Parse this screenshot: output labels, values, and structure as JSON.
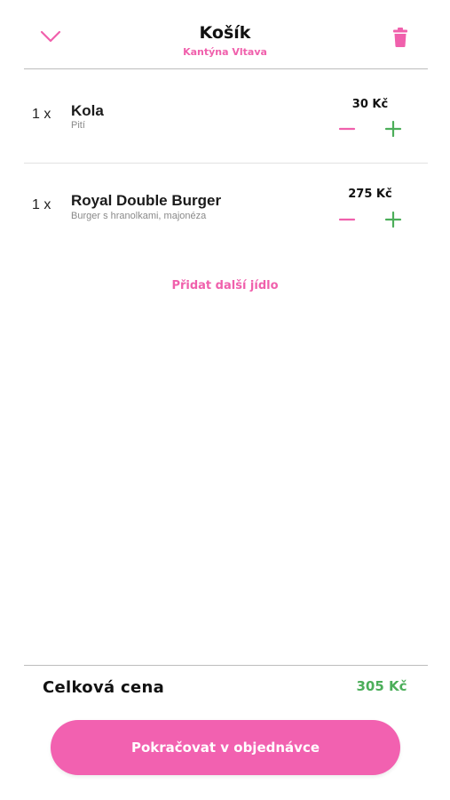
{
  "header": {
    "title": "Košík",
    "subtitle": "Kantýna Vltava"
  },
  "colors": {
    "accent": "#f060ac",
    "positive": "#4cae5a"
  },
  "icons": {
    "back": "chevron-down-icon",
    "delete": "trash-icon",
    "decrease": "minus-icon",
    "increase": "plus-icon"
  },
  "items": [
    {
      "qty": "1 x",
      "name": "Kola",
      "description": "Pití",
      "price": "30 Kč"
    },
    {
      "qty": "1 x",
      "name": "Royal Double Burger",
      "description": "Burger s hranolkami, majonéza",
      "price": "275 Kč"
    }
  ],
  "add_more_label": "Přidat další jídlo",
  "summary": {
    "total_label": "Celková cena",
    "total_value": "305 Kč"
  },
  "continue_label": "Pokračovat v objednávce"
}
